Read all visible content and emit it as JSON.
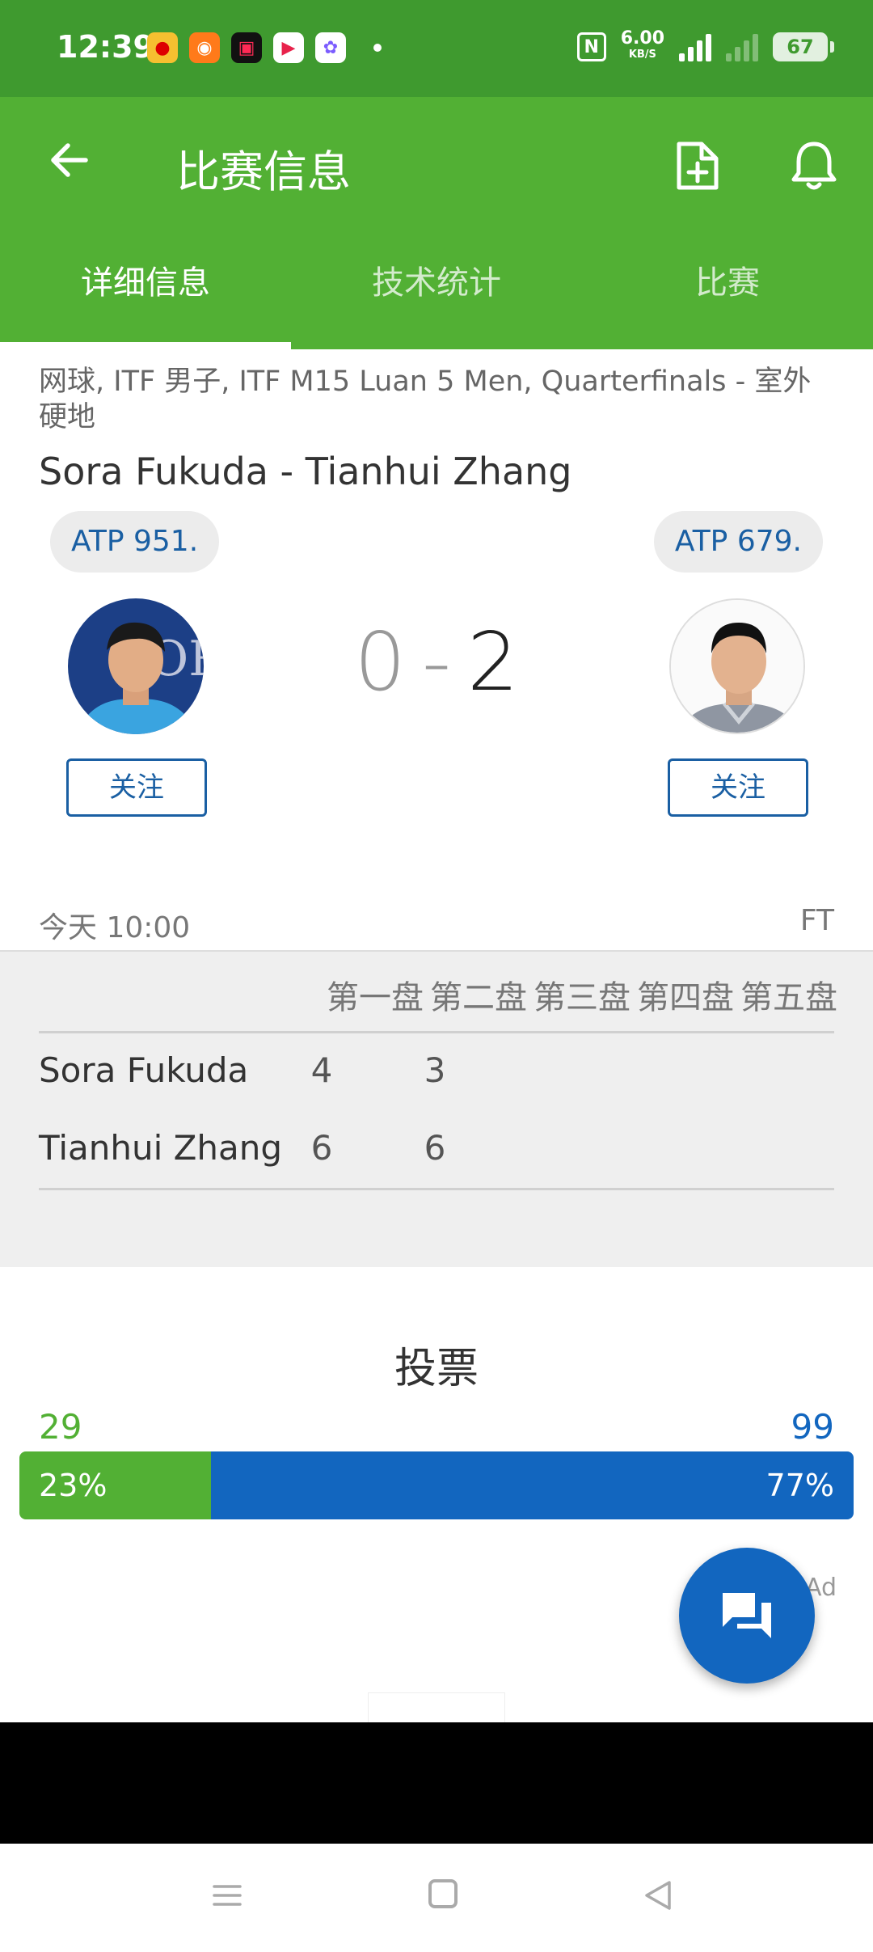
{
  "status_bar": {
    "time": "12:39",
    "net_speed": "6.00",
    "net_unit": "KB/S",
    "network": "5G",
    "battery": "67"
  },
  "app_bar": {
    "title": "比赛信息"
  },
  "tabs": [
    {
      "label": "详细信息"
    },
    {
      "label": "技术统计"
    },
    {
      "label": "比赛"
    }
  ],
  "match": {
    "meta": "网球, ITF 男子, ITF M15 Luan 5 Men, Quarterfinals - 室外硬地",
    "name": "Sora Fukuda - Tianhui Zhang",
    "home": {
      "rank": "ATP 951.",
      "follow": "关注"
    },
    "away": {
      "rank": "ATP 679.",
      "follow": "关注"
    },
    "score_home": "0",
    "score_separator": "-",
    "score_away": "2",
    "time": "今天 10:00",
    "status": "FT"
  },
  "sets": {
    "headers": [
      "第一盘",
      "第二盘",
      "第三盘",
      "第四盘",
      "第五盘"
    ],
    "rows": [
      {
        "player": "Sora Fukuda",
        "scores": [
          "4",
          "3"
        ]
      },
      {
        "player": "Tianhui Zhang",
        "scores": [
          "6",
          "6"
        ]
      }
    ]
  },
  "vote": {
    "title": "投票",
    "left_count": "29",
    "right_count": "99",
    "left_pct": "23%",
    "right_pct": "77%",
    "left_fraction": 0.23
  },
  "ad_label": "Ad",
  "colors": {
    "green": "#52b034",
    "dark_green": "#3f9a2f",
    "blue": "#1266bf",
    "link_blue": "#1a5fa3"
  }
}
